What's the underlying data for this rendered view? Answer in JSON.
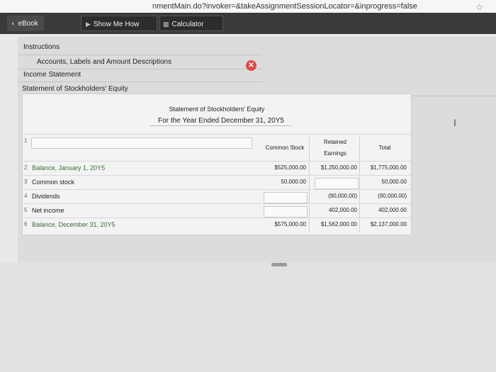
{
  "browser": {
    "url": "nmentMain.do?invoker=&takeAssignmentSessionLocator=&inprogress=false",
    "star_icon": "star-icon"
  },
  "toolbar": {
    "ebook_label": "eBook",
    "show_me_how_label": "Show Me How",
    "calculator_label": "Calculator"
  },
  "tabs": {
    "instructions": "Instructions",
    "accounts": "Accounts, Labels and Amount Descriptions",
    "income_statement": "Income Statement",
    "stockholders_equity": "Statement of Stockholders' Equity"
  },
  "statement": {
    "title": "Statement of Stockholders' Equity",
    "period": "For the Year Ended December 31, 20Y5",
    "col_common": "Common Stock",
    "col_retained_1": "Retained",
    "col_retained_2": "Earnings",
    "col_total": "Total",
    "rows": [
      {
        "num": "1",
        "label": "",
        "common": "",
        "retained": "",
        "total": ""
      },
      {
        "num": "2",
        "label": "Balance, January 1, 20Y5",
        "common": "$525,000.00",
        "retained": "$1,250,000.00",
        "total": "$1,775,000.00"
      },
      {
        "num": "3",
        "label": "Common stock",
        "common": "50,000.00",
        "retained": "",
        "total": "50,000.00"
      },
      {
        "num": "4",
        "label": "Dividends",
        "common": "",
        "retained": "(90,000.00)",
        "total": "(90,000.00)"
      },
      {
        "num": "5",
        "label": "Net income",
        "common": "",
        "retained": "402,000.00",
        "total": "402,000.00"
      },
      {
        "num": "6",
        "label": "Balance, December 31, 20Y5",
        "common": "$575,000.00",
        "retained": "$1,562,000.00",
        "total": "$2,137,000.00"
      }
    ]
  },
  "colors": {
    "toolbar_bg": "#3a3a3a",
    "close_button": "#e04848",
    "label_green": "#3b6b3b"
  }
}
